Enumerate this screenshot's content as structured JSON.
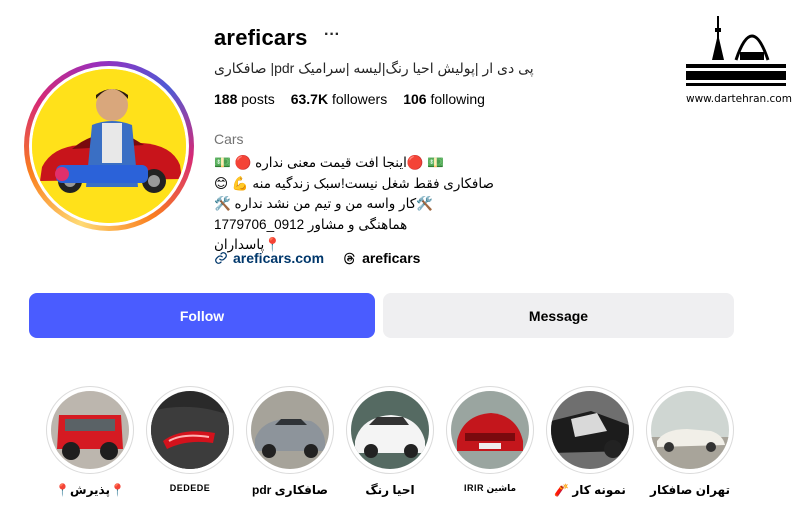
{
  "profile": {
    "username": "areficars",
    "more_icon": "ellipsis-icon",
    "title_line": "صافکاری |pdr پی دی ار |پولیش احیا رنگ|لیسه |سرامیک",
    "stats": {
      "posts_count": "188",
      "posts_label": "posts",
      "followers_count": "63.7K",
      "followers_label": "followers",
      "following_count": "106",
      "following_label": "following"
    },
    "category": "Cars",
    "bio": [
      "💵 🔴اینجا افت قیمت معنی نداره 🔴 💵",
      "صافکاری فقط شغل نیست!سبک زندگیه منه 💪 😊",
      "🛠️کار واسه من و تیم من نشد نداره 🛠️",
      "هماهنگی و مشاور 0912_1779706",
      "📍پاسداران"
    ],
    "website": "areficars.com",
    "threads_handle": "areficars",
    "avatar_text": "تهران صافکار"
  },
  "buttons": {
    "follow": "Follow",
    "message": "Message"
  },
  "highlights": [
    {
      "label": "تهران صافکار",
      "kind": "cars-lot"
    },
    {
      "label": "نمونه کار 🧨",
      "kind": "wreck"
    },
    {
      "label": "ماشین IRIR",
      "kind": "peugeot"
    },
    {
      "label": "احیا رنگ",
      "kind": "white-car"
    },
    {
      "label": "صافکاری pdr",
      "kind": "grey-car"
    },
    {
      "label": "DEDEDE",
      "kind": "taillight"
    },
    {
      "label": "📍پذیرش📍",
      "kind": "red-jeep"
    }
  ],
  "watermark": {
    "brand": "در تهـــــران",
    "url": "www.dartehran.com"
  },
  "colors": {
    "follow_bg": "#4a5cff",
    "message_bg": "#efeff1",
    "link": "#00376b",
    "avatar_bg": "#ffe11a"
  }
}
